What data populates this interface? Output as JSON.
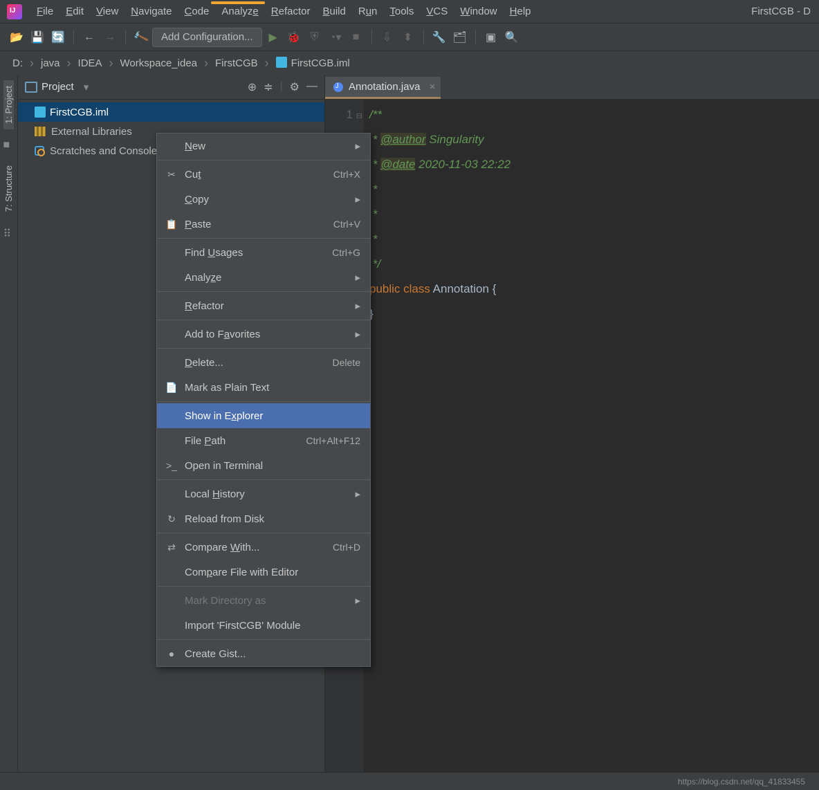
{
  "title_right": "FirstCGB - D",
  "menubar": [
    "File",
    "Edit",
    "View",
    "Navigate",
    "Code",
    "Analyze",
    "Refactor",
    "Build",
    "Run",
    "Tools",
    "VCS",
    "Window",
    "Help"
  ],
  "menubar_underline": [
    0,
    0,
    0,
    0,
    0,
    6,
    0,
    0,
    1,
    0,
    0,
    0,
    0
  ],
  "toolbar": {
    "add_configuration": "Add Configuration..."
  },
  "breadcrumb": [
    "D:",
    "java",
    "IDEA",
    "Workspace_idea",
    "FirstCGB",
    "FirstCGB.iml"
  ],
  "panel": {
    "title": "Project"
  },
  "tree": {
    "items": [
      {
        "label": "FirstCGB.iml",
        "selected": true,
        "icon": "iml"
      },
      {
        "label": "External Libraries",
        "icon": "lib"
      },
      {
        "label": "Scratches and Consoles",
        "icon": "scratch"
      }
    ]
  },
  "tab": {
    "label": "Annotation.java"
  },
  "gutter_line": "1",
  "code": {
    "l1": "/**",
    "l2": " * ",
    "l2tag": "@author",
    "l2val": " Singularity",
    "l3": " * ",
    "l3tag": "@date",
    "l3val": " 2020-11-03 22:22",
    "l4": " *",
    "l5": " *",
    "l6": " *",
    "l7": " */",
    "l8a": "public ",
    "l8b": "class ",
    "l8c": "Annotation ",
    "l8d": "{",
    "l9": "}"
  },
  "context_menu": [
    {
      "label": "New",
      "type": "sub"
    },
    {
      "type": "sep"
    },
    {
      "label": "Cut",
      "shortcut": "Ctrl+X",
      "icon": "✂"
    },
    {
      "label": "Copy",
      "type": "sub"
    },
    {
      "label": "Paste",
      "shortcut": "Ctrl+V",
      "icon": "📋"
    },
    {
      "type": "sep"
    },
    {
      "label": "Find Usages",
      "shortcut": "Ctrl+G"
    },
    {
      "label": "Analyze",
      "type": "sub"
    },
    {
      "type": "sep"
    },
    {
      "label": "Refactor",
      "type": "sub"
    },
    {
      "type": "sep"
    },
    {
      "label": "Add to Favorites",
      "type": "sub"
    },
    {
      "type": "sep"
    },
    {
      "label": "Delete...",
      "shortcut": "Delete"
    },
    {
      "label": "Mark as Plain Text",
      "icon": "📄"
    },
    {
      "type": "sep"
    },
    {
      "label": "Show in Explorer",
      "highlight": true
    },
    {
      "label": "File Path",
      "shortcut": "Ctrl+Alt+F12"
    },
    {
      "label": "Open in Terminal",
      "icon": ">_"
    },
    {
      "type": "sep"
    },
    {
      "label": "Local History",
      "type": "sub"
    },
    {
      "label": "Reload from Disk",
      "icon": "↻"
    },
    {
      "type": "sep"
    },
    {
      "label": "Compare With...",
      "shortcut": "Ctrl+D",
      "icon": "⇄"
    },
    {
      "label": "Compare File with Editor"
    },
    {
      "type": "sep"
    },
    {
      "label": "Mark Directory as",
      "type": "sub",
      "disabled": true
    },
    {
      "label": "Import 'FirstCGB' Module"
    },
    {
      "type": "sep"
    },
    {
      "label": "Create Gist...",
      "icon": "●"
    }
  ],
  "watermark": "https://blog.csdn.net/qq_41833455"
}
